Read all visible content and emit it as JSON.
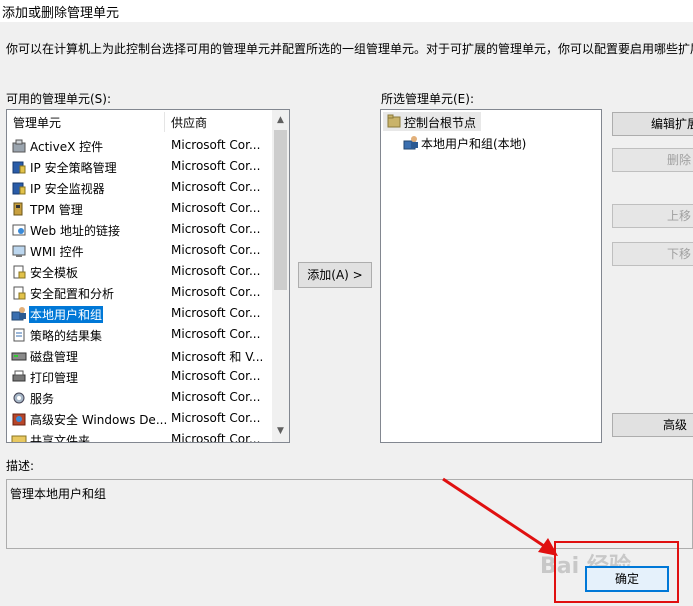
{
  "window": {
    "title": "添加或删除管理单元"
  },
  "intro": "你可以在计算机上为此控制台选择可用的管理单元并配置所选的一组管理单元。对于可扩展的管理单元，你可以配置要启用哪些扩展。",
  "available": {
    "label": "可用的管理单元(S):",
    "col_name": "管理单元",
    "col_vendor": "供应商",
    "items": [
      {
        "name": "ActiveX 控件",
        "vendor": "Microsoft Cor...",
        "icon": "activex-icon",
        "selected": false
      },
      {
        "name": "IP 安全策略管理",
        "vendor": "Microsoft Cor...",
        "icon": "ip-security-policy-icon",
        "selected": false
      },
      {
        "name": "IP 安全监视器",
        "vendor": "Microsoft Cor...",
        "icon": "ip-security-monitor-icon",
        "selected": false
      },
      {
        "name": "TPM 管理",
        "vendor": "Microsoft Cor...",
        "icon": "tpm-icon",
        "selected": false
      },
      {
        "name": "Web 地址的链接",
        "vendor": "Microsoft Cor...",
        "icon": "web-link-icon",
        "selected": false
      },
      {
        "name": "WMI 控件",
        "vendor": "Microsoft Cor...",
        "icon": "wmi-icon",
        "selected": false
      },
      {
        "name": "安全模板",
        "vendor": "Microsoft Cor...",
        "icon": "security-template-icon",
        "selected": false
      },
      {
        "name": "安全配置和分析",
        "vendor": "Microsoft Cor...",
        "icon": "security-config-icon",
        "selected": false
      },
      {
        "name": "本地用户和组",
        "vendor": "Microsoft Cor...",
        "icon": "users-groups-icon",
        "selected": true
      },
      {
        "name": "策略的结果集",
        "vendor": "Microsoft Cor...",
        "icon": "policy-result-icon",
        "selected": false
      },
      {
        "name": "磁盘管理",
        "vendor": "Microsoft 和 V...",
        "icon": "disk-icon",
        "selected": false
      },
      {
        "name": "打印管理",
        "vendor": "Microsoft Cor...",
        "icon": "printer-icon",
        "selected": false
      },
      {
        "name": "服务",
        "vendor": "Microsoft Cor...",
        "icon": "services-gear-icon",
        "selected": false
      },
      {
        "name": "高级安全 Windows De...",
        "vendor": "Microsoft Cor...",
        "icon": "firewall-icon",
        "selected": false
      },
      {
        "name": "共享文件夹",
        "vendor": "Microsoft Cor...",
        "icon": "shared-folder-icon",
        "selected": false
      }
    ]
  },
  "add_button": "添加(A) >",
  "selected_panel": {
    "label": "所选管理单元(E):",
    "root": "控制台根节点",
    "child": "本地用户和组(本地)"
  },
  "right_buttons": {
    "edit_ext": "编辑扩展",
    "remove": "删除",
    "move_up": "上移",
    "move_down": "下移",
    "advanced": "高级"
  },
  "description": {
    "label": "描述:",
    "text": "管理本地用户和组"
  },
  "ok_button": "确定",
  "watermark": "Bai 经验",
  "colors": {
    "selection": "#0078d7",
    "annotation": "#e01010"
  }
}
